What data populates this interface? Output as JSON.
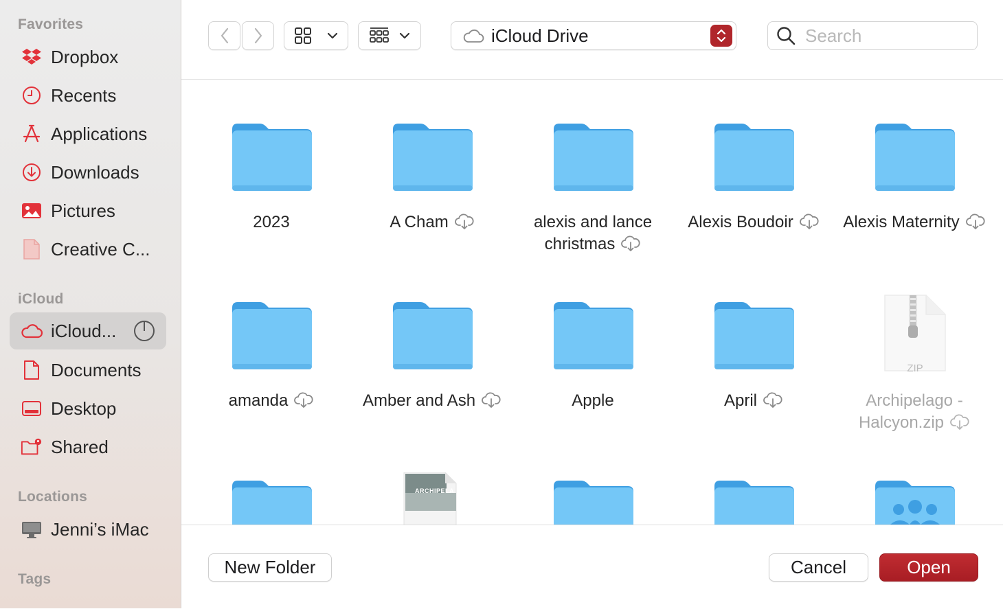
{
  "sidebar": {
    "sections": [
      {
        "title": "Favorites",
        "items": [
          {
            "label": "Dropbox",
            "icon": "dropbox-icon"
          },
          {
            "label": "Recents",
            "icon": "clock-icon"
          },
          {
            "label": "Applications",
            "icon": "applications-icon"
          },
          {
            "label": "Downloads",
            "icon": "download-icon"
          },
          {
            "label": "Pictures",
            "icon": "photo-icon"
          },
          {
            "label": "Creative C...",
            "icon": "document-icon"
          }
        ]
      },
      {
        "title": "iCloud",
        "items": [
          {
            "label": "iCloud...",
            "icon": "cloud-icon",
            "selected": true
          },
          {
            "label": "Documents",
            "icon": "document-icon"
          },
          {
            "label": "Desktop",
            "icon": "desktop-icon"
          },
          {
            "label": "Shared",
            "icon": "shared-folder-icon"
          }
        ]
      },
      {
        "title": "Locations",
        "items": [
          {
            "label": "Jenni’s iMac",
            "icon": "imac-icon"
          }
        ]
      },
      {
        "title": "Tags",
        "items": []
      }
    ]
  },
  "toolbar": {
    "location": "iCloud Drive",
    "search_placeholder": "Search"
  },
  "files": [
    {
      "name": "2023",
      "kind": "folder",
      "cloud": false
    },
    {
      "name": "A Cham",
      "kind": "folder",
      "cloud": true
    },
    {
      "name": "alexis and lance christmas",
      "kind": "folder",
      "cloud": true
    },
    {
      "name": "Alexis Boudoir",
      "kind": "folder",
      "cloud": true
    },
    {
      "name": "Alexis Maternity",
      "kind": "folder",
      "cloud": true
    },
    {
      "name": "amanda",
      "kind": "folder",
      "cloud": true
    },
    {
      "name": "Amber and Ash",
      "kind": "folder",
      "cloud": true
    },
    {
      "name": "Apple",
      "kind": "folder",
      "cloud": false
    },
    {
      "name": "April",
      "kind": "folder",
      "cloud": true
    },
    {
      "name": "Archipelago - Halcyon.zip",
      "kind": "zip",
      "cloud": true,
      "dimmed": true,
      "zip_label": "ZIP"
    },
    {
      "name": "",
      "kind": "folder",
      "cloud": false
    },
    {
      "name": "",
      "kind": "document",
      "cloud": false,
      "thumb_text": "ARCHIPELA"
    },
    {
      "name": "",
      "kind": "folder",
      "cloud": false
    },
    {
      "name": "",
      "kind": "folder",
      "cloud": false
    },
    {
      "name": "",
      "kind": "shared-folder",
      "cloud": false
    }
  ],
  "buttons": {
    "new_folder": "New Folder",
    "cancel": "Cancel",
    "open": "Open"
  },
  "colors": {
    "accent": "#b0262b",
    "sidebar_icon": "#e2323a",
    "folder_light": "#74c7f7",
    "folder_dark": "#3f9fe2"
  }
}
